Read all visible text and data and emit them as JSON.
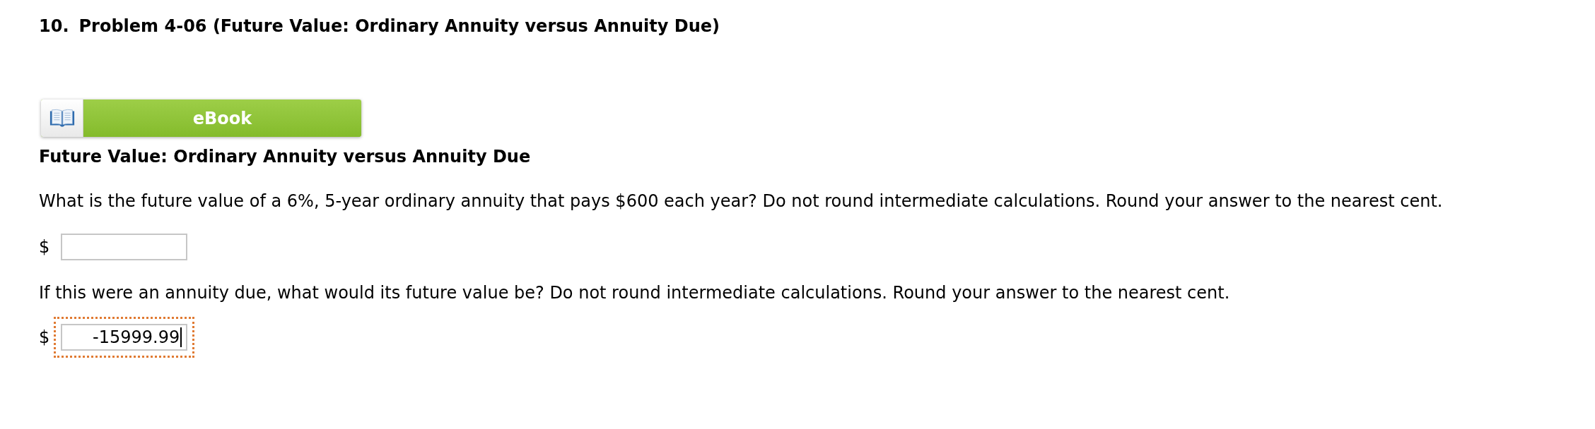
{
  "problem": {
    "number": "10.",
    "title": "Problem 4-06 (Future Value: Ordinary Annuity versus Annuity Due)"
  },
  "ebook_button": {
    "label": "eBook"
  },
  "section_heading": "Future Value: Ordinary Annuity versus Annuity Due",
  "questions": [
    {
      "prompt": "What is the future value of a 6%, 5-year ordinary annuity that pays $600 each year? Do not round intermediate calculations. Round your answer to the nearest cent.",
      "answer": {
        "currency": "$",
        "focused": false
      }
    },
    {
      "prompt": "If this were an annuity due, what would its future value be? Do not round intermediate calculations. Round your answer to the nearest cent.",
      "answer": {
        "currency": "$",
        "value": "-15999.99",
        "focused": true
      }
    }
  ]
}
